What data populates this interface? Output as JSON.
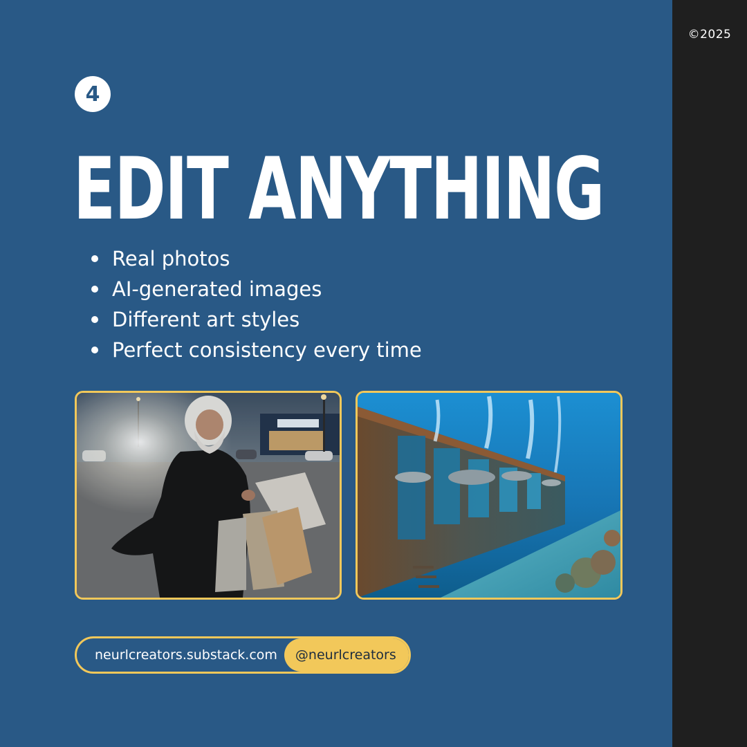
{
  "copyright": "©2025",
  "step_number": "4",
  "title": "EDIT ANYTHING",
  "bullets": [
    "Real photos",
    "AI-generated images",
    "Different art styles",
    "Perfect consistency every time"
  ],
  "photos": [
    {
      "subject": "bearded-man-with-shopping-bags-photo"
    },
    {
      "subject": "underwater-train-with-dolphins-photo"
    }
  ],
  "footer": {
    "url": "neurlcreators.substack.com",
    "handle": "@neurlcreators"
  },
  "colors": {
    "background": "#295986",
    "side_bar": "#1f1f1f",
    "accent": "#f2c85a",
    "text": "#ffffff"
  }
}
